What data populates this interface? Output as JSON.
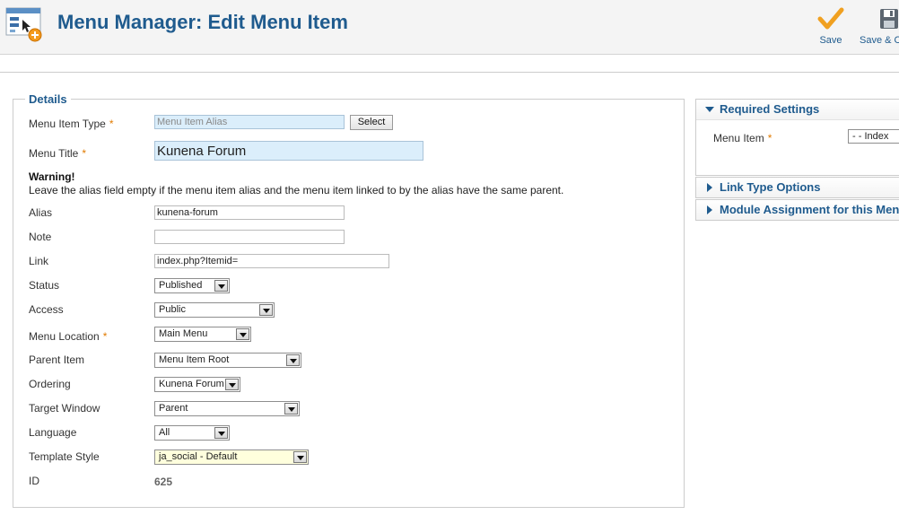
{
  "header": {
    "title": "Menu Manager: Edit Menu Item",
    "toolbar": {
      "save_label": "Save",
      "save_close_label": "Save & C"
    }
  },
  "details": {
    "legend": "Details",
    "menu_item_type": {
      "label": "Menu Item Type",
      "value": "Menu Item Alias",
      "button": "Select"
    },
    "menu_title": {
      "label": "Menu Title",
      "value": "Kunena Forum"
    },
    "warning": {
      "title": "Warning!",
      "text": "Leave the alias field empty if the menu item alias and the menu item linked to by the alias have the same parent."
    },
    "alias": {
      "label": "Alias",
      "value": "kunena-forum"
    },
    "note": {
      "label": "Note",
      "value": ""
    },
    "link": {
      "label": "Link",
      "value": "index.php?Itemid="
    },
    "status": {
      "label": "Status",
      "value": "Published"
    },
    "access": {
      "label": "Access",
      "value": "Public"
    },
    "menu_location": {
      "label": "Menu Location",
      "value": "Main Menu"
    },
    "parent_item": {
      "label": "Parent Item",
      "value": "Menu Item Root"
    },
    "ordering": {
      "label": "Ordering",
      "value": "Kunena Forum"
    },
    "target_window": {
      "label": "Target Window",
      "value": "Parent"
    },
    "language": {
      "label": "Language",
      "value": "All"
    },
    "template_style": {
      "label": "Template Style",
      "value": "ja_social - Default"
    },
    "id": {
      "label": "ID",
      "value": "625"
    },
    "required_marker": "*"
  },
  "sidebar": {
    "required_settings": {
      "title": "Required Settings",
      "menu_item_label": "Menu Item",
      "menu_item_value": "- - Index"
    },
    "link_type_options": "Link Type Options",
    "module_assignment": "Module Assignment for this Men"
  },
  "colors": {
    "accent": "#1f5b8e",
    "required_star": "#e17b00",
    "highlight_input": "#dbeefb",
    "template_highlight": "#ffffdd"
  }
}
